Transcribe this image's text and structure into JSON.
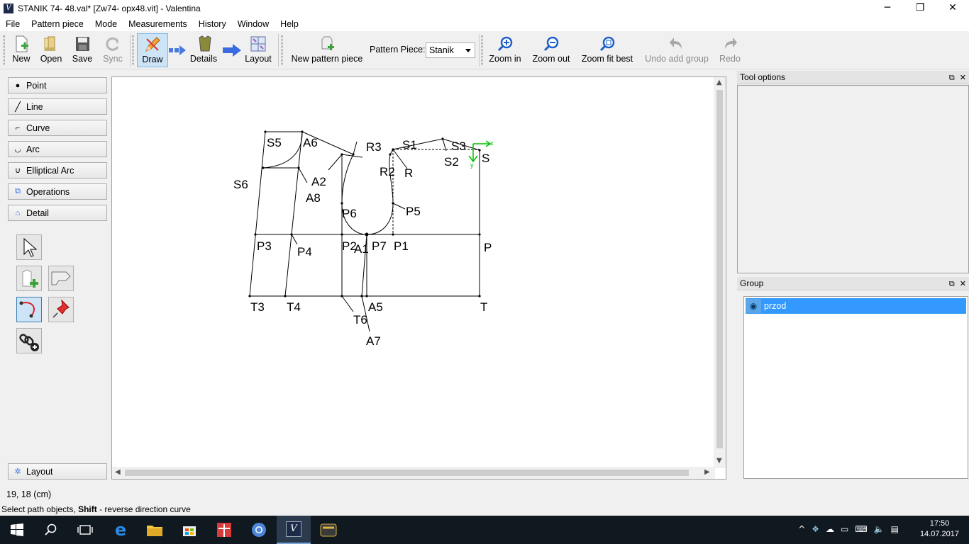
{
  "window": {
    "title": "STANIK 74- 48.val* [Zw74- opx48.vit] - Valentina",
    "app_icon_glyph": "V"
  },
  "window_controls": {
    "minimize": "─",
    "restore": "❐",
    "close": "✕"
  },
  "menu": [
    "File",
    "Pattern piece",
    "Mode",
    "Measurements",
    "History",
    "Window",
    "Help"
  ],
  "toolbar": {
    "new": "New",
    "open": "Open",
    "save": "Save",
    "sync": "Sync",
    "draw": "Draw",
    "details": "Details",
    "layout": "Layout",
    "new_piece": "New pattern piece",
    "pattern_piece_label": "Pattern Piece:",
    "pattern_piece_value": "Stanik",
    "zoom_in": "Zoom in",
    "zoom_out": "Zoom out",
    "zoom_fit": "Zoom fit best",
    "undo": "Undo add group",
    "redo": "Redo"
  },
  "toolbox": {
    "point": "Point",
    "line": "Line",
    "curve": "Curve",
    "arc": "Arc",
    "elliptical_arc": "Elliptical Arc",
    "operations": "Operations",
    "detail": "Detail",
    "layout": "Layout"
  },
  "pattern_labels": {
    "S5": "S5",
    "A6": "A6",
    "R3": "R3",
    "S1": "S1",
    "S3": "S3",
    "S": "S",
    "S2": "S2",
    "R2": "R2",
    "R": "R",
    "S6": "S6",
    "A2": "A2",
    "A8": "A8",
    "P6": "P6",
    "P5": "P5",
    "P3": "P3",
    "P4": "P4",
    "P2": "P2",
    "A1": "A1",
    "P7": "P7",
    "P1": "P1",
    "P": "P",
    "T3": "T3",
    "T4": "T4",
    "A5": "A5",
    "T": "T",
    "T6": "T6",
    "A7": "A7",
    "axis_x": "x",
    "axis_y": "y"
  },
  "docks": {
    "tool_options": "Tool options",
    "group": "Group",
    "group_items": [
      {
        "name": "przod",
        "visible": true
      }
    ]
  },
  "status": {
    "coords": "19, 18 (cm)",
    "hint_prefix": "Select path objects, ",
    "hint_key": "Shift",
    "hint_suffix": " - reverse direction curve"
  },
  "taskbar": {
    "time": "17:50",
    "date": "14.07.2017",
    "apps": [
      "start",
      "search",
      "task-view",
      "edge",
      "file-explorer",
      "store",
      "gift",
      "chrome",
      "valentina",
      "tape"
    ]
  },
  "colors": {
    "selection": "#3399ff",
    "axis": "#00c000",
    "draw_active": "#cde4f7"
  }
}
